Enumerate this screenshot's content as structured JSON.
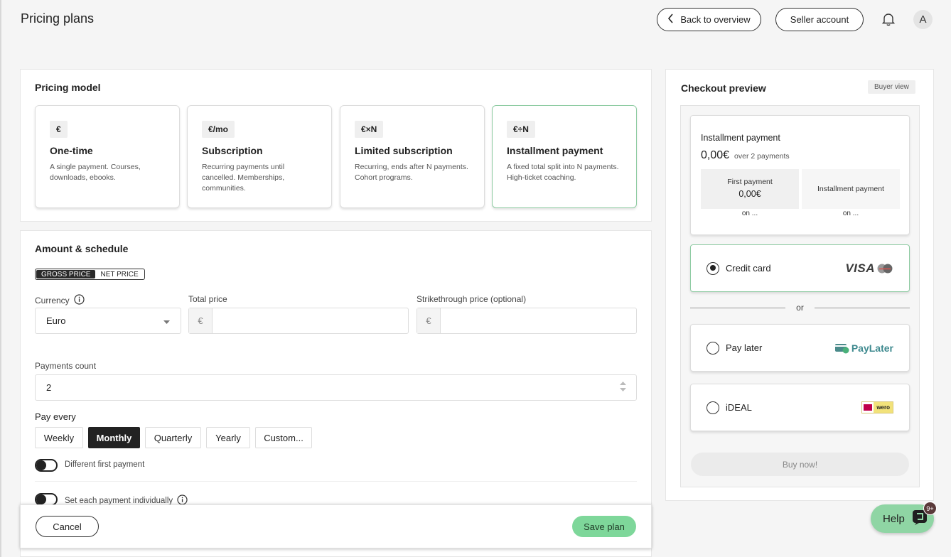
{
  "header": {
    "title": "Pricing plans",
    "back_label": "Back to overview",
    "seller_label": "Seller account",
    "avatar_initial": "A"
  },
  "pricing_model": {
    "title": "Pricing model",
    "options": [
      {
        "icon": "€",
        "name": "One-time",
        "desc": "A single payment. Courses, downloads, ebooks.",
        "selected": false
      },
      {
        "icon": "€/mo",
        "name": "Subscription",
        "desc": "Recurring payments until cancelled. Memberships, communities.",
        "selected": false
      },
      {
        "icon": "€×N",
        "name": "Limited subscription",
        "desc": "Recurring, ends after N payments. Cohort programs.",
        "selected": false
      },
      {
        "icon": "€÷N",
        "name": "Installment payment",
        "desc": "A fixed total split into N payments. High-ticket coaching.",
        "selected": true
      }
    ]
  },
  "amount": {
    "title": "Amount & schedule",
    "price_toggle": {
      "gross": "GROSS PRICE",
      "net": "NET PRICE",
      "selected": "gross"
    },
    "currency_label": "Currency",
    "currency_value": "Euro",
    "total_label": "Total price",
    "strike_label": "Strikethrough price (optional)",
    "currency_symbol": "€",
    "payments_count_label": "Payments count",
    "payments_count_value": "2",
    "pay_every_label": "Pay every",
    "intervals": [
      "Weekly",
      "Monthly",
      "Quarterly",
      "Yearly",
      "Custom..."
    ],
    "interval_selected": "Monthly",
    "diff_first_label": "Different first payment",
    "individual_label": "Set each payment individually"
  },
  "footer": {
    "cancel_label": "Cancel",
    "save_label": "Save plan"
  },
  "preview": {
    "title": "Checkout preview",
    "badge": "Buyer view",
    "plan_name": "Installment payment",
    "amount": "0,00€",
    "over_text": "over 2 payments",
    "first_payment_label": "First payment",
    "first_payment_amount": "0,00€",
    "installment_label": "Installment payment",
    "on_text_1": "on ...",
    "on_text_2": "on ...",
    "methods": [
      {
        "name": "Credit card",
        "selected": true
      },
      {
        "name": "Pay later",
        "selected": false
      },
      {
        "name": "iDEAL",
        "selected": false
      }
    ],
    "or_text": "or",
    "visa_text": "VISA",
    "paylater_text": "PayLater",
    "wero_text": "wero",
    "buy_label": "Buy now!"
  },
  "help": {
    "label": "Help",
    "badge": "9+"
  },
  "colors": {
    "accent_green": "#7ed79a",
    "selected_border": "#8fcca3",
    "dark": "#222222"
  }
}
